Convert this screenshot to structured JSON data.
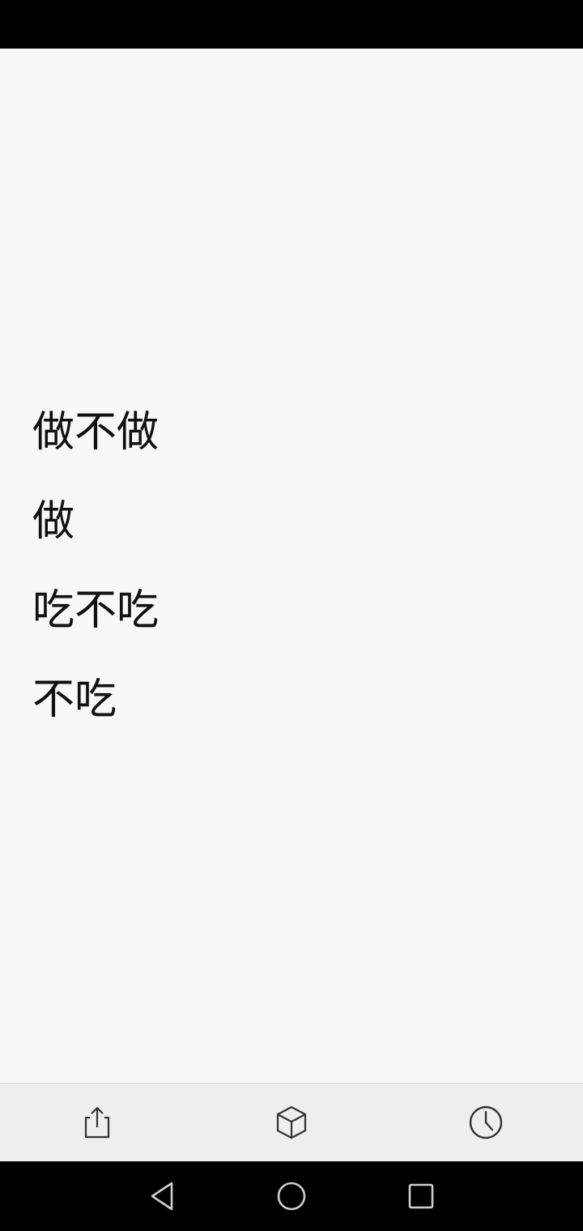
{
  "content": {
    "lines": [
      "做不做",
      "做",
      "吃不吃",
      "不吃"
    ]
  },
  "toolbar": {
    "icons": [
      "share-icon",
      "cube-icon",
      "history-icon"
    ]
  },
  "navigation": {
    "icons": [
      "back-icon",
      "home-icon",
      "recents-icon"
    ]
  },
  "colors": {
    "status_bar": "#000000",
    "background": "#f8f8f8",
    "toolbar": "#eeeeee",
    "text": "#111111",
    "nav_bar": "#000000"
  }
}
